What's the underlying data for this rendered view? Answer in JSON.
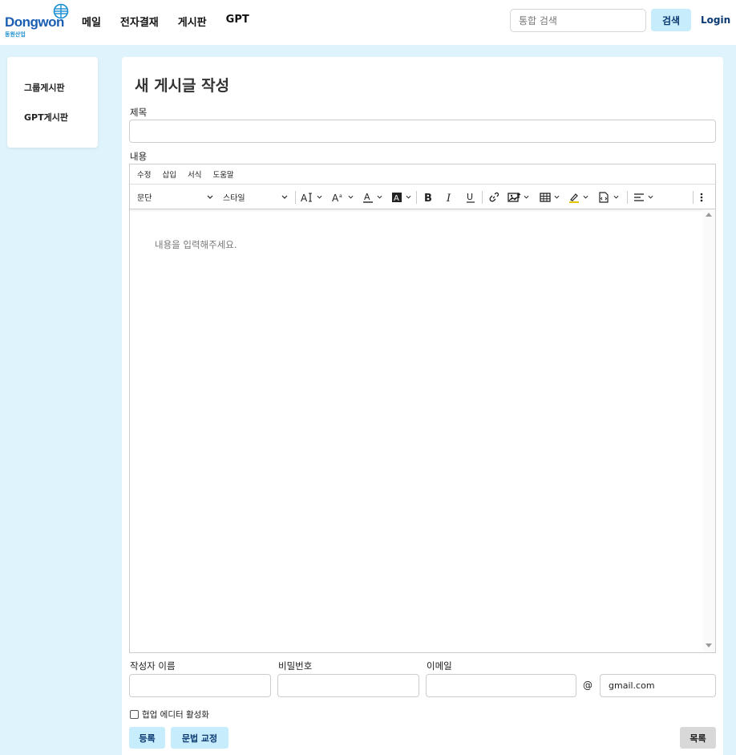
{
  "brand": {
    "name": "Dongwon",
    "sub": "동원산업",
    "color": "#1a5fb4"
  },
  "nav": {
    "items": [
      "메일",
      "전자결재",
      "게시판",
      "GPT"
    ]
  },
  "search": {
    "placeholder": "통합 검색",
    "button": "검색"
  },
  "login": "Login",
  "sidebar": {
    "items": [
      "그룹게시판",
      "GPT게시판"
    ]
  },
  "page": {
    "title": "새 게시글 작성"
  },
  "form": {
    "title_label": "제목",
    "content_label": "내용",
    "author_label": "작성자 이름",
    "password_label": "비밀번호",
    "email_label": "이메일",
    "at_sign": "@",
    "email_domain": "gmail.com",
    "collab_label": "협업 에디터 활성화",
    "submit": "등록",
    "grammar": "문법 교정",
    "list": "목록"
  },
  "editor": {
    "menus": [
      "수정",
      "삽입",
      "서식",
      "도움말"
    ],
    "block_format": "문단",
    "style": "스타일",
    "placeholder": "내용을 입력해주세요."
  },
  "colors": {
    "accent": "#c7ecfb",
    "background": "#dff3fc",
    "button_text": "#0b3a73"
  }
}
